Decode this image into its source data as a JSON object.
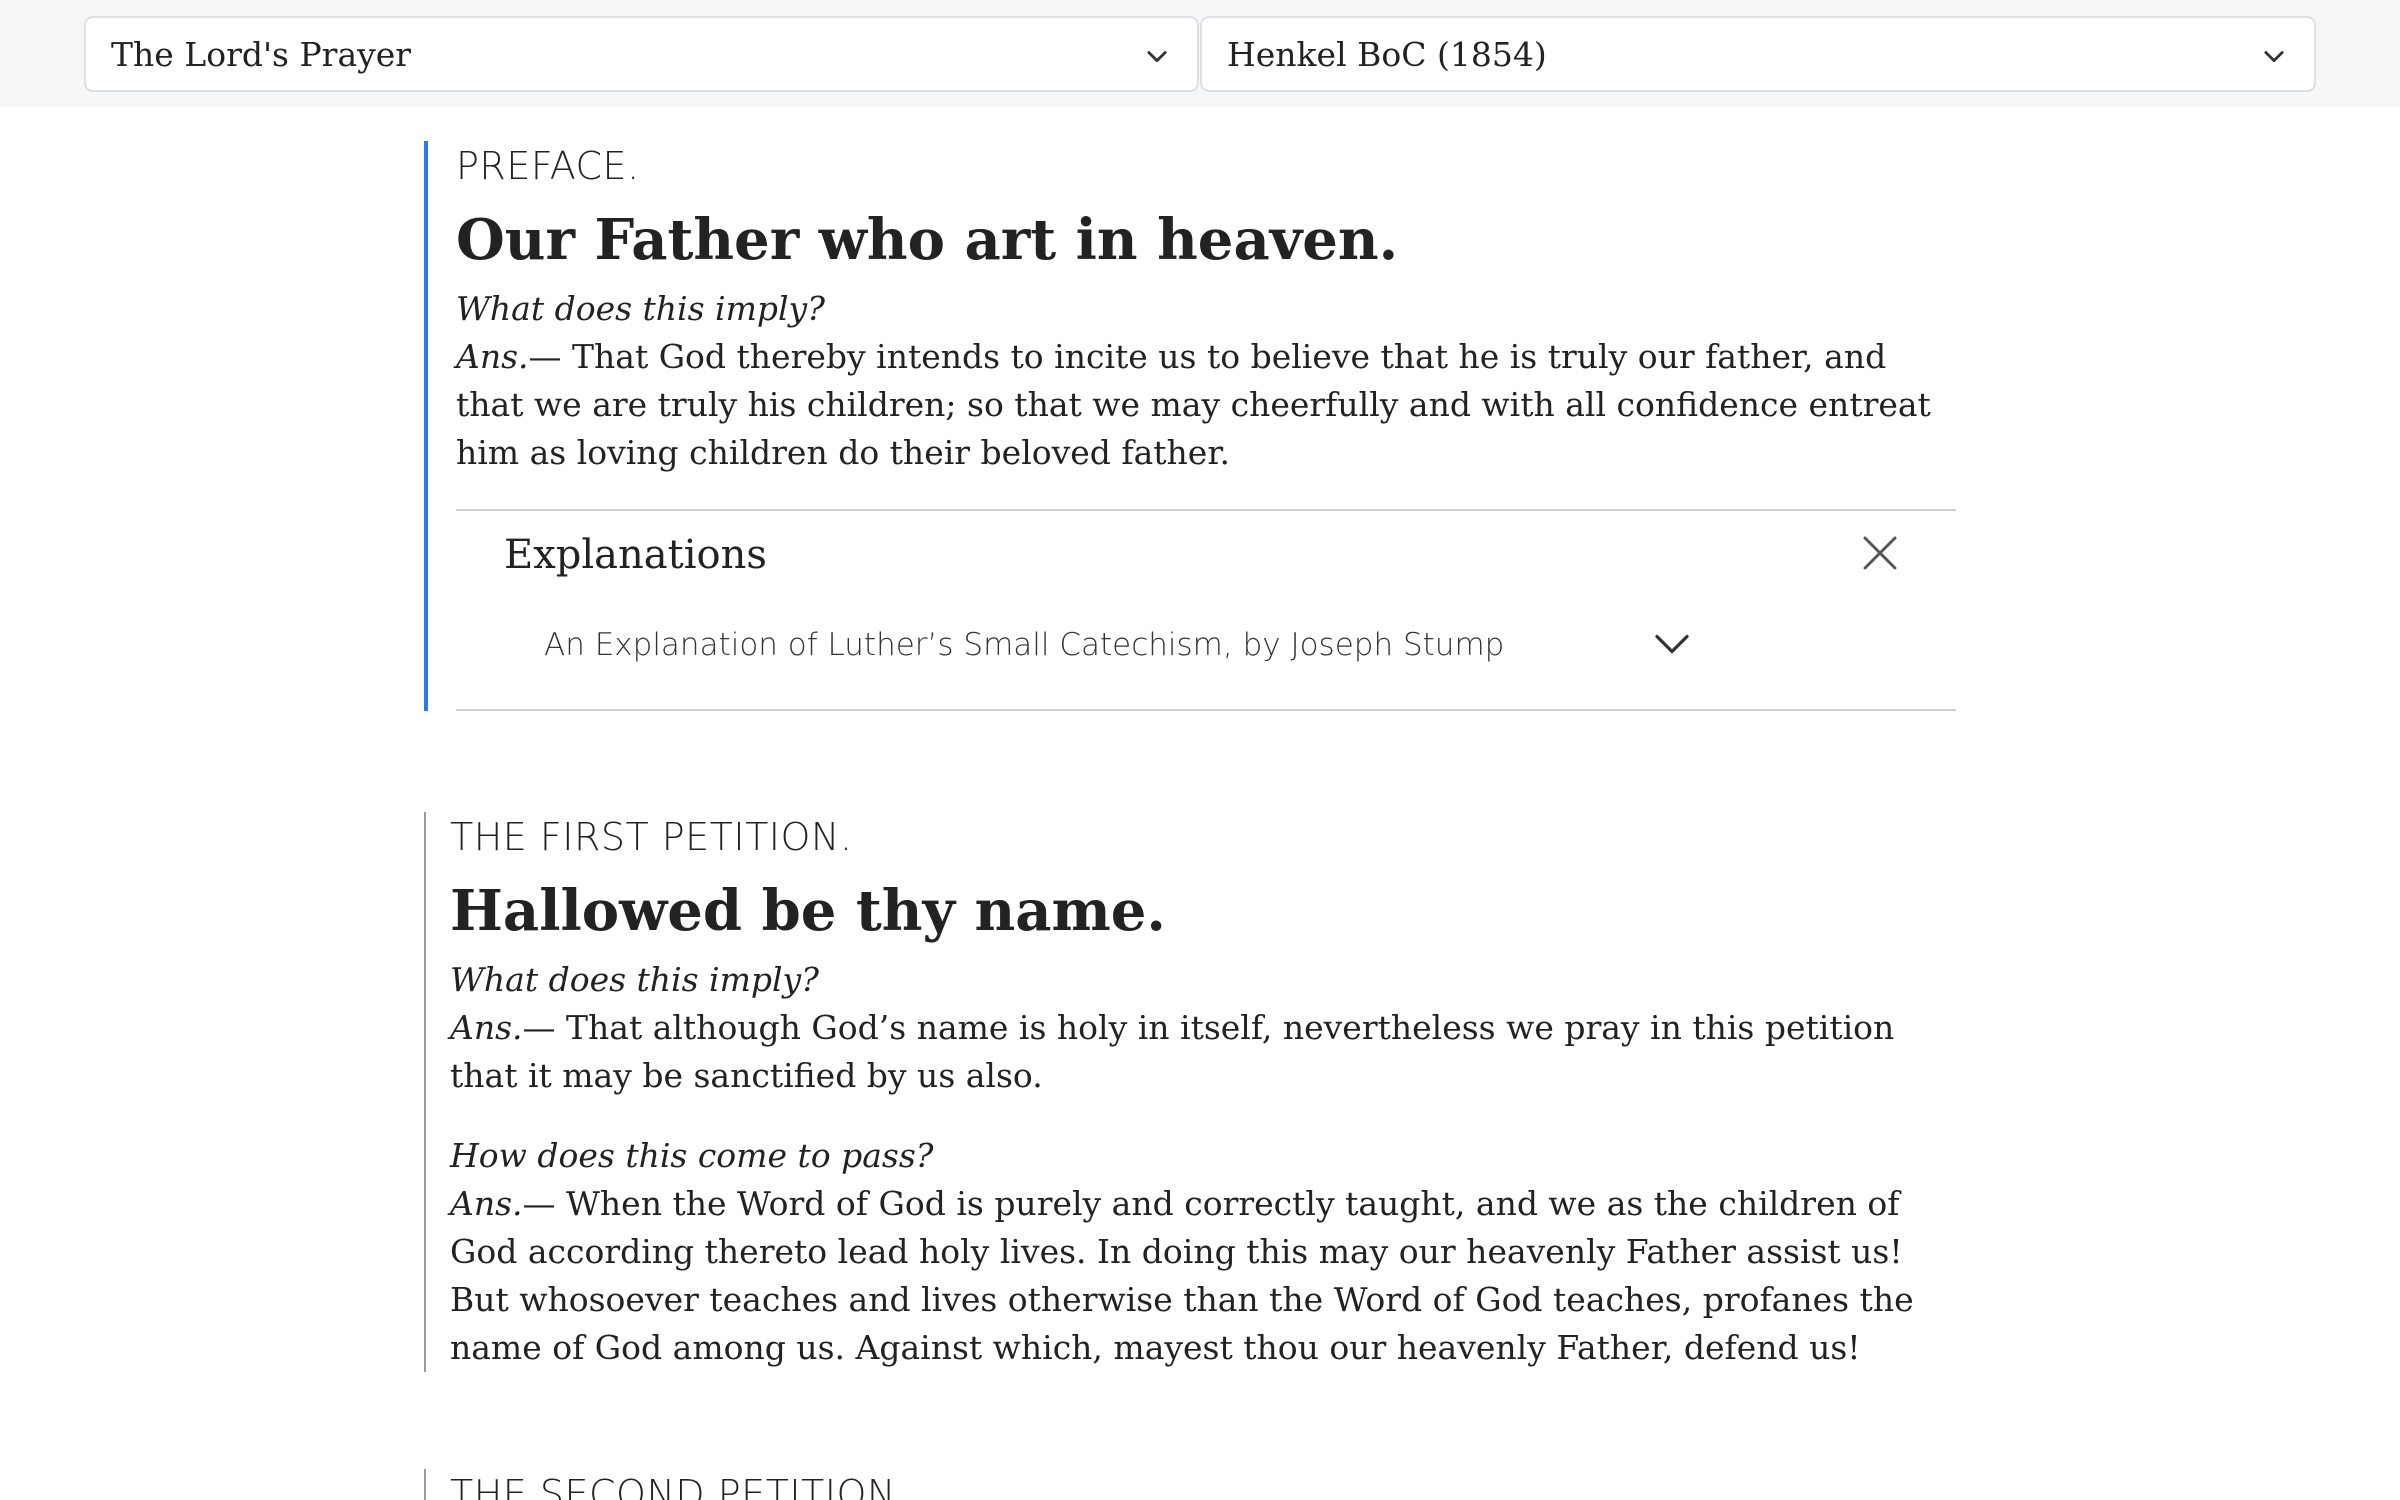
{
  "selectors": {
    "topic": "The Lord's Prayer",
    "edition": "Henkel BoC (1854)"
  },
  "sections": [
    {
      "heading": "PREFACE.",
      "title": "Our Father who art in heaven.",
      "qa": [
        {
          "question": "What does this imply?",
          "ans_label": "Ans.",
          "answer": "— That God thereby intends to incite us to believe that he is truly our father, and that we are truly his children; so that we may cheerfully and with all confidence entreat him as loving children do their beloved father."
        }
      ],
      "explanations": {
        "title": "Explanations",
        "item": "An Explanation of Luther’s Small Catechism, by Joseph Stump"
      }
    },
    {
      "heading": "THE FIRST PETITION.",
      "title": "Hallowed be thy name.",
      "qa": [
        {
          "question": "What does this imply?",
          "ans_label": "Ans.",
          "answer": "— That although God’s name is holy in itself, nevertheless we pray in this petition that it may be sanctified by us also."
        },
        {
          "question": "How does this come to pass?",
          "ans_label": "Ans.",
          "answer": "— When the Word of God is purely and correctly taught, and we as the children of God according thereto lead holy lives. In doing this may our heavenly Father assist us! But whosoever teaches and lives otherwise than the Word of God teaches, profanes the name of God among us. Against which, mayest thou our heavenly Father, defend us!"
        }
      ]
    },
    {
      "heading": "THE SECOND PETITION."
    }
  ],
  "colors": {
    "accent": "#2a7be4",
    "topbar": "#f6f7f9"
  }
}
